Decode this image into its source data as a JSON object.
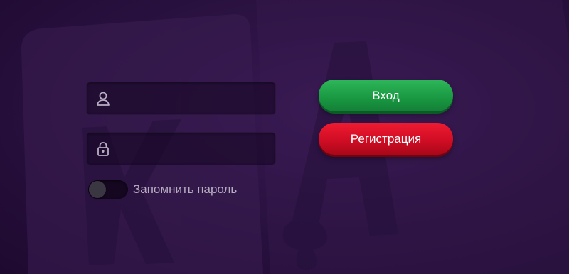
{
  "colors": {
    "background": "#2b1242",
    "login_button": "#1a9a43",
    "register_button": "#d00d24",
    "label_text": "#b7adc0"
  },
  "login_form": {
    "username": {
      "icon": "user-icon",
      "value": "",
      "placeholder": ""
    },
    "password": {
      "icon": "lock-icon",
      "value": "",
      "placeholder": ""
    },
    "remember": {
      "label": "Запомнить пароль",
      "checked": false
    }
  },
  "actions": {
    "login_label": "Вход",
    "register_label": "Регистрация"
  }
}
